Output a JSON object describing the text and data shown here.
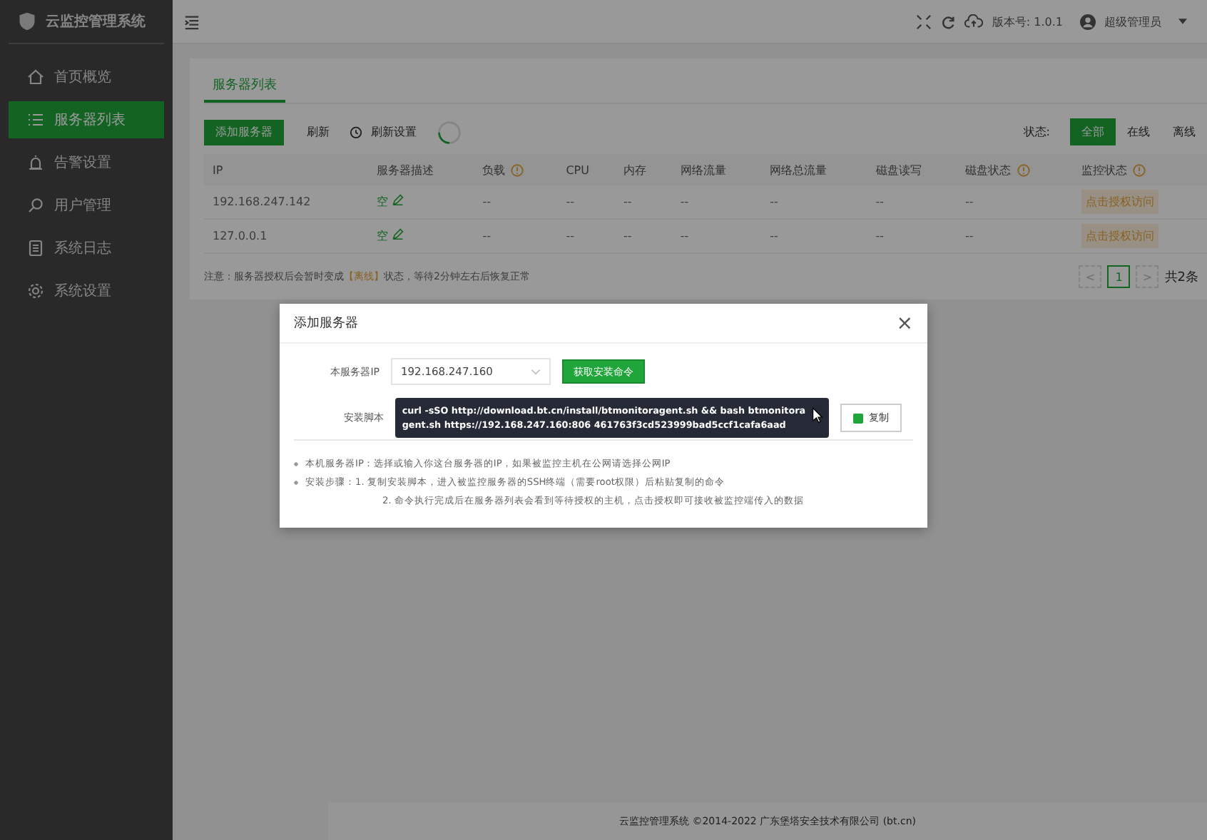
{
  "sidebar": {
    "logo": "云监控管理系统",
    "items": [
      {
        "label": "首页概览",
        "selected": false
      },
      {
        "label": "服务器列表",
        "selected": true
      },
      {
        "label": "告警设置",
        "selected": false
      },
      {
        "label": "用户管理",
        "selected": false
      },
      {
        "label": "系统日志",
        "selected": false
      },
      {
        "label": "系统设置",
        "selected": false
      }
    ]
  },
  "header": {
    "version": "版本号: 1.0.1",
    "user": "超级管理员"
  },
  "tabs": [
    {
      "label": "服务器列表",
      "selected": true
    }
  ],
  "toolbar": {
    "add": "添加服务器",
    "refresh": "刷新",
    "refresh_settings": "刷新设置",
    "status_label": "状态:",
    "filters": [
      {
        "label": "全部",
        "selected": true
      },
      {
        "label": "在线",
        "selected": false
      },
      {
        "label": "离线",
        "selected": false
      }
    ]
  },
  "table": {
    "columns": [
      {
        "label": "IP",
        "info": false
      },
      {
        "label": "服务器描述",
        "info": false
      },
      {
        "label": "负载",
        "info": true
      },
      {
        "label": "CPU",
        "info": false
      },
      {
        "label": "内存",
        "info": false
      },
      {
        "label": "网络流量",
        "info": false
      },
      {
        "label": "网络总流量",
        "info": false
      },
      {
        "label": "磁盘读写",
        "info": false
      },
      {
        "label": "磁盘状态",
        "info": true
      },
      {
        "label": "监控状态",
        "info": true
      }
    ],
    "rows": [
      {
        "cells": [
          "192.168.247.142",
          "空",
          "--",
          "--",
          "--",
          "--",
          "--",
          "--",
          "--",
          "点击授权访问"
        ]
      },
      {
        "cells": [
          "127.0.0.1",
          "空",
          "--",
          "--",
          "--",
          "--",
          "--",
          "--",
          "--",
          "点击授权访问"
        ]
      }
    ]
  },
  "note": {
    "before": "注意：服务器授权后会暂时变成",
    "highlight": "【离线】",
    "after": "状态，等待2分钟左右后恢复正常"
  },
  "pagination": {
    "prev": "<",
    "pages": [
      {
        "label": "1",
        "selected": true
      }
    ],
    "next": ">",
    "total": "共2条"
  },
  "dialog": {
    "title": "添加服务器",
    "close": "×",
    "ip_label": "本服务器IP",
    "ip_value": "192.168.247.160",
    "get_command": "获取安装命令",
    "script_label": "安装脚本",
    "script": "curl -sSO http://download.bt.cn/install/btmonitoragent.sh && bash btmonitoragent.sh https://192.168.247.160:806 461763f3cd523999bad5ccf1cafa6aad",
    "copy": "复制",
    "tips": [
      {
        "text": "本机服务器IP：选择或输入你这台服务器的IP，如果被监控主机在公网请选择公网IP",
        "bullet": true
      },
      {
        "text": "安装步骤：1. 复制安装脚本，进入被监控服务器的SSH终端（需要root权限）后粘贴复制的命令",
        "bullet": true
      },
      {
        "text": "2. 命令执行完成后在服务器列表会看到等待授权的主机，点击授权即可接收被监控端传入的数据",
        "bullet": false
      }
    ]
  },
  "footer": "云监控管理系统 ©2014-2022 广东堡塔安全技术有限公司 (bt.cn)"
}
